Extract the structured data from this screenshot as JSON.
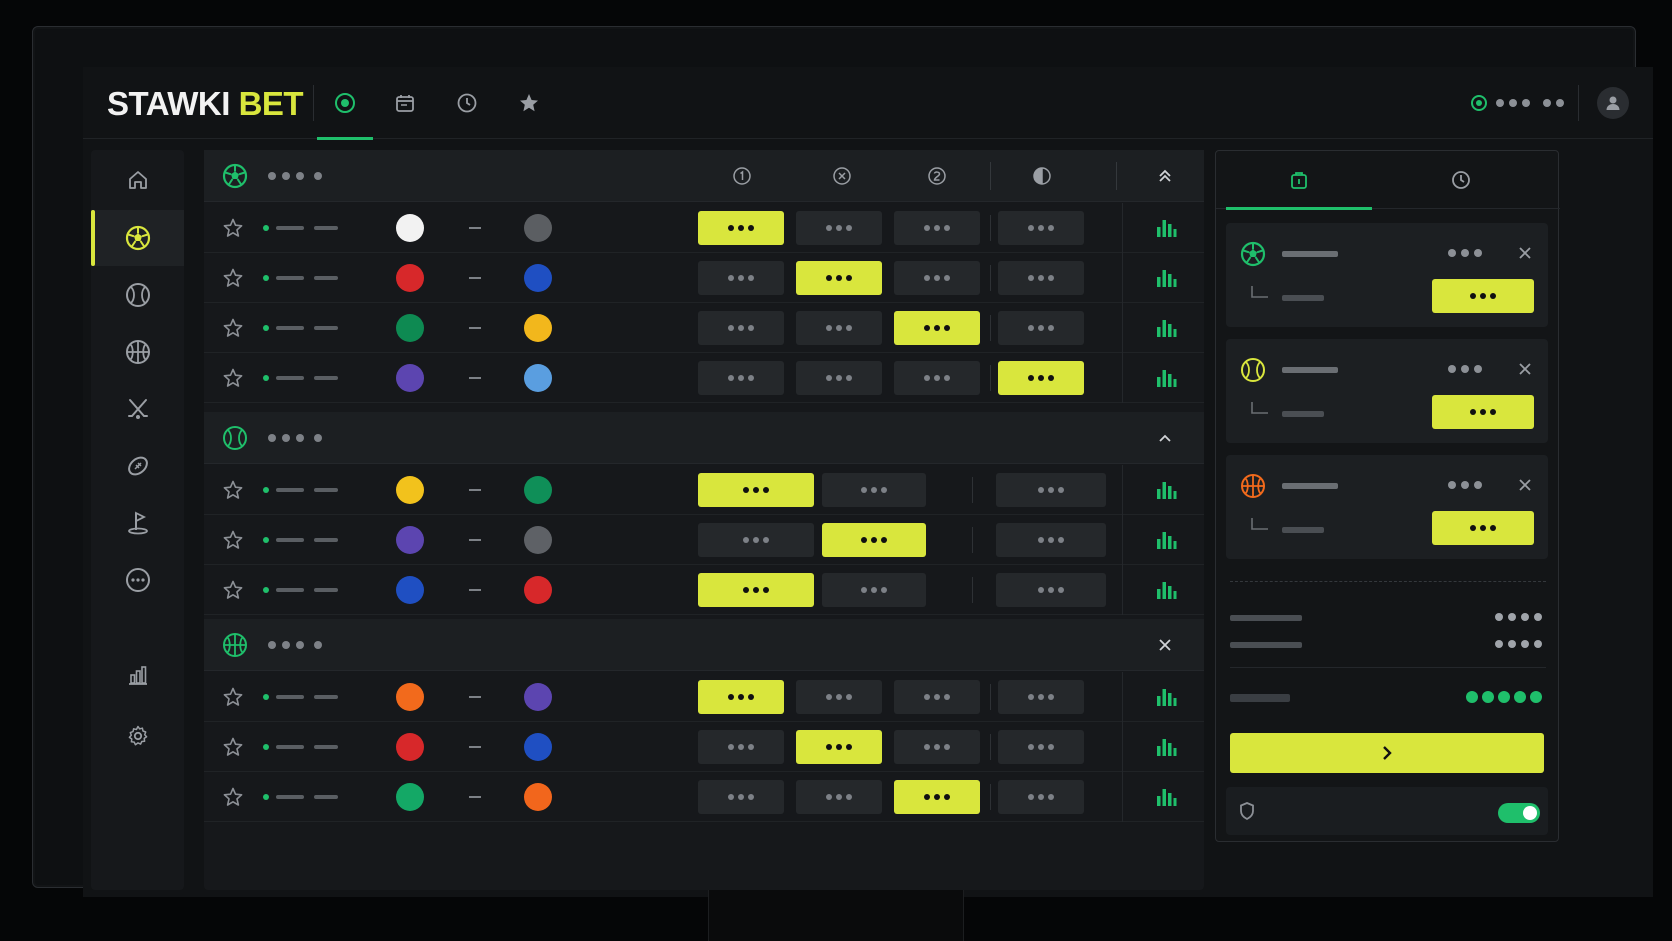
{
  "app": {
    "title_main": "STAWKI",
    "title_accent": "BET"
  },
  "colors": {
    "accent": "#d9e63d",
    "live": "#1fbf6b",
    "bg": "#111315",
    "panel": "#16181b"
  },
  "header": {
    "tabs": [
      {
        "icon": "live-target-icon",
        "active": true
      },
      {
        "icon": "calendar-icon",
        "active": false
      },
      {
        "icon": "clock-icon",
        "active": false
      },
      {
        "icon": "star-icon",
        "active": false
      }
    ],
    "status_icon": "live-status-icon",
    "user_icon": "user-avatar-icon"
  },
  "sidebar": {
    "items": [
      {
        "icon": "home-icon",
        "active": false
      },
      {
        "icon": "soccer-ball-icon",
        "active": true
      },
      {
        "icon": "tennis-ball-icon",
        "active": false
      },
      {
        "icon": "basketball-icon",
        "active": false
      },
      {
        "icon": "hockey-sticks-icon",
        "active": false
      },
      {
        "icon": "rugby-ball-icon",
        "active": false
      },
      {
        "icon": "golf-flag-icon",
        "active": false
      },
      {
        "icon": "more-options-icon",
        "active": false
      },
      {
        "icon": "statistics-icon",
        "active": false
      },
      {
        "icon": "settings-gear-icon",
        "active": false
      }
    ]
  },
  "markets": {
    "column_icons": [
      "outcome-1-icon",
      "outcome-x-icon",
      "outcome-2-icon",
      "half-time-icon"
    ],
    "groups": [
      {
        "sport_icon": "soccer-ball-icon",
        "action_icon": "collapse-all-icon",
        "matches": [
          {
            "home": "#f2f2f2",
            "away": "#5b5e62",
            "selected": 0
          },
          {
            "home": "#d7282a",
            "away": "#1f4fc2",
            "selected": 1
          },
          {
            "home": "#0e8a52",
            "away": "#f2b71c",
            "selected": 2
          },
          {
            "home": "#5c45b0",
            "away": "#5a9ee0",
            "selected": 3
          }
        ]
      },
      {
        "sport_icon": "tennis-ball-icon",
        "action_icon": "chevron-up-icon",
        "matches": [
          {
            "home": "#f2c21c",
            "away": "#0f8f58",
            "selected": 0
          },
          {
            "home": "#5c45b0",
            "away": "#5e6166",
            "selected": 1
          },
          {
            "home": "#1f4fc2",
            "away": "#d7282a",
            "selected": 0
          }
        ]
      },
      {
        "sport_icon": "basketball-icon",
        "action_icon": "close-icon",
        "matches": [
          {
            "home": "#f26a1c",
            "away": "#5c45b0",
            "selected": 0
          },
          {
            "home": "#d7282a",
            "away": "#1f4fc2",
            "selected": 1
          },
          {
            "home": "#14a866",
            "away": "#f2661c",
            "selected": 2
          }
        ]
      }
    ]
  },
  "betslip": {
    "tabs": [
      {
        "icon": "bet-ticket-icon",
        "active": true
      },
      {
        "icon": "history-clock-icon",
        "active": false
      }
    ],
    "selections": [
      {
        "sport_icon": "soccer-ball-icon",
        "color": "#1fbf6b"
      },
      {
        "sport_icon": "tennis-ball-icon",
        "color": "#d9e63d"
      },
      {
        "sport_icon": "basketball-icon",
        "color": "#f26a1c"
      }
    ],
    "submit_icon": "chevron-right-icon",
    "shield_icon": "shield-icon",
    "toggle_on": true
  }
}
